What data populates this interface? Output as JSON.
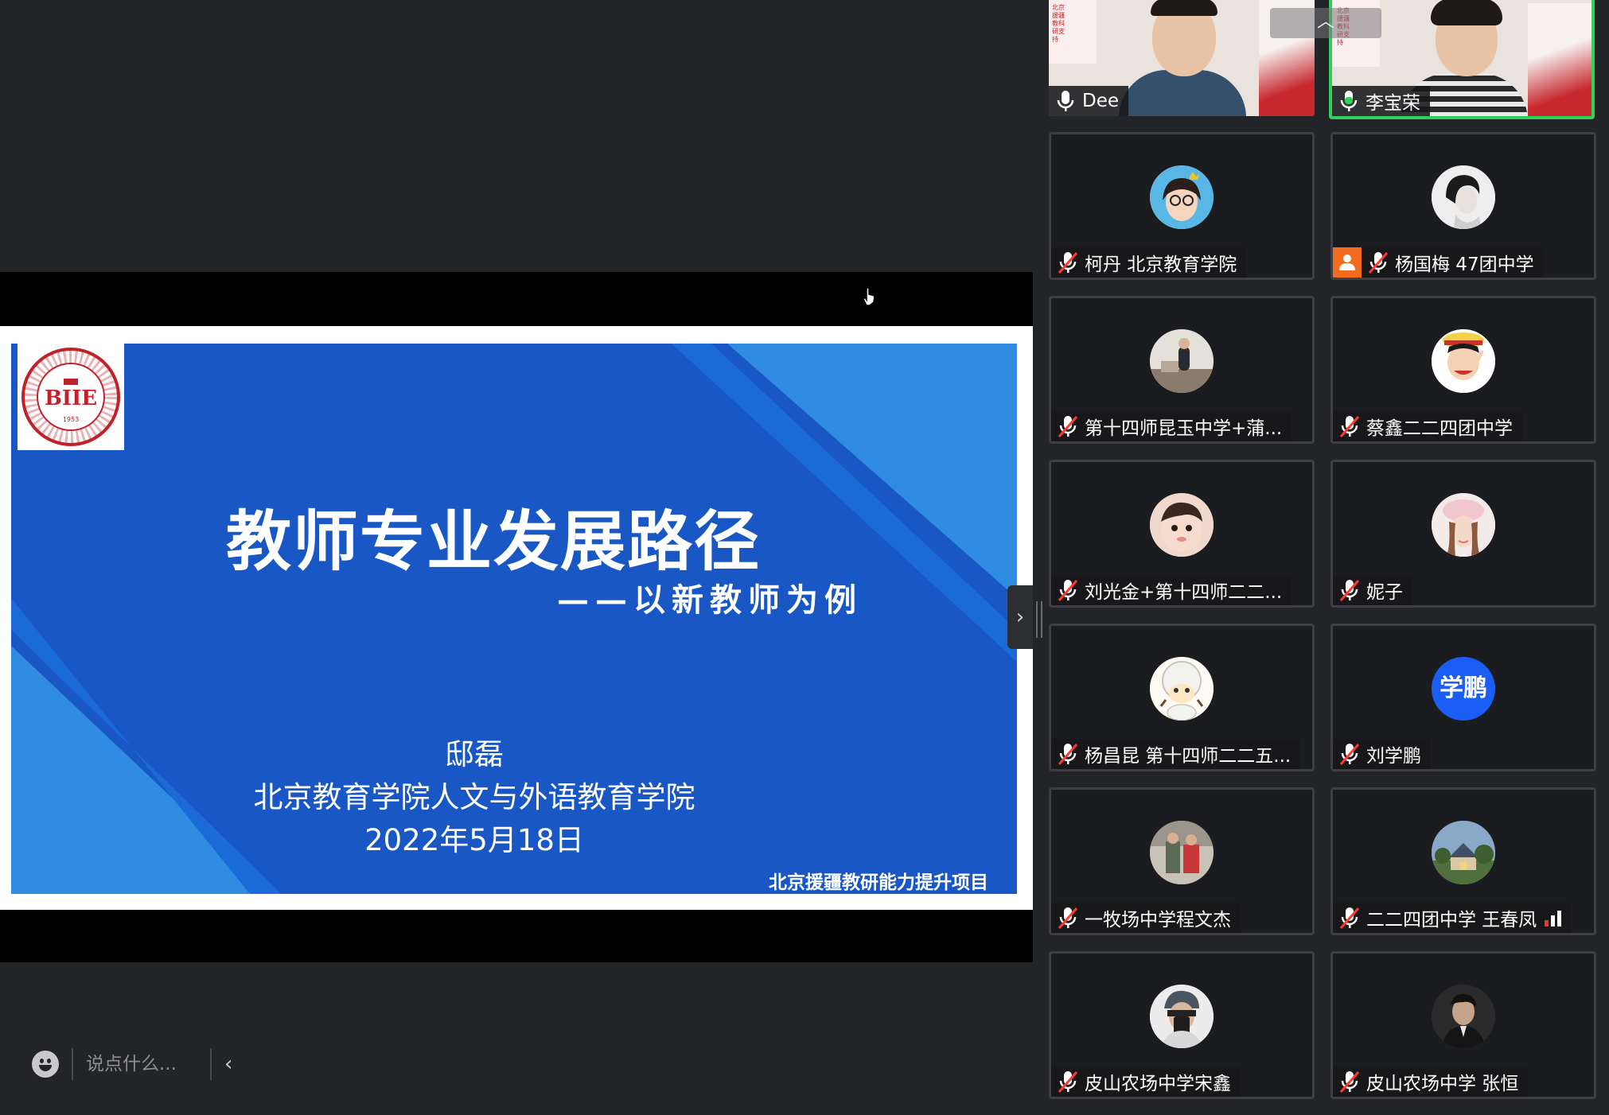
{
  "slide": {
    "title": "教师专业发展路径",
    "subtitle": "——以新教师为例",
    "author": "邸磊",
    "organization": "北京教育学院人文与外语教育学院",
    "date": "2022年5月18日",
    "project": "北京援疆教研能力提升项目",
    "logo_text": "BIIE",
    "logo_ring_text": "北京教育学院 · BEIJING INSTITUTE OF EDUCATION",
    "logo_year": "1953",
    "colors": {
      "slide_blue": "#1857c4",
      "accent_light": "#2f8ce0"
    }
  },
  "chat": {
    "placeholder": "说点什么...",
    "emoji_icon": "smiley-icon",
    "collapse_icon": "chevron-left-icon"
  },
  "gallery": {
    "scroll_up_icon": "chevron-up-icon",
    "video_banner_text": "北京援疆教科研支持",
    "participants": [
      {
        "name": "Dee",
        "muted": false,
        "video": true,
        "active": false
      },
      {
        "name": "李宝荣",
        "muted": false,
        "video": true,
        "active": true
      },
      {
        "name": "柯丹 北京教育学院",
        "muted": true
      },
      {
        "name": "杨国梅 47团中学",
        "muted": true,
        "host": true
      },
      {
        "name": "第十四师昆玉中学+蒲...",
        "muted": true
      },
      {
        "name": "蔡鑫二二四团中学",
        "muted": true
      },
      {
        "name": "刘光金+第十四师二二...",
        "muted": true
      },
      {
        "name": "妮子",
        "muted": true
      },
      {
        "name": "杨昌昆 第十四师二二五...",
        "muted": true
      },
      {
        "name": "刘学鹏",
        "muted": true,
        "initials": "学鹏"
      },
      {
        "name": "一牧场中学程文杰",
        "muted": true
      },
      {
        "name": "二二四团中学 王春凤",
        "muted": true,
        "signal": "weak"
      },
      {
        "name": "皮山农场中学宋鑫",
        "muted": true
      },
      {
        "name": "皮山农场中学 张恒",
        "muted": true
      }
    ]
  },
  "colors": {
    "background": "#232427",
    "active_speaker": "#2fd158",
    "host_badge": "#f36b1c",
    "muted_icon": "#ffffff",
    "signal_weak": "#e53935"
  }
}
